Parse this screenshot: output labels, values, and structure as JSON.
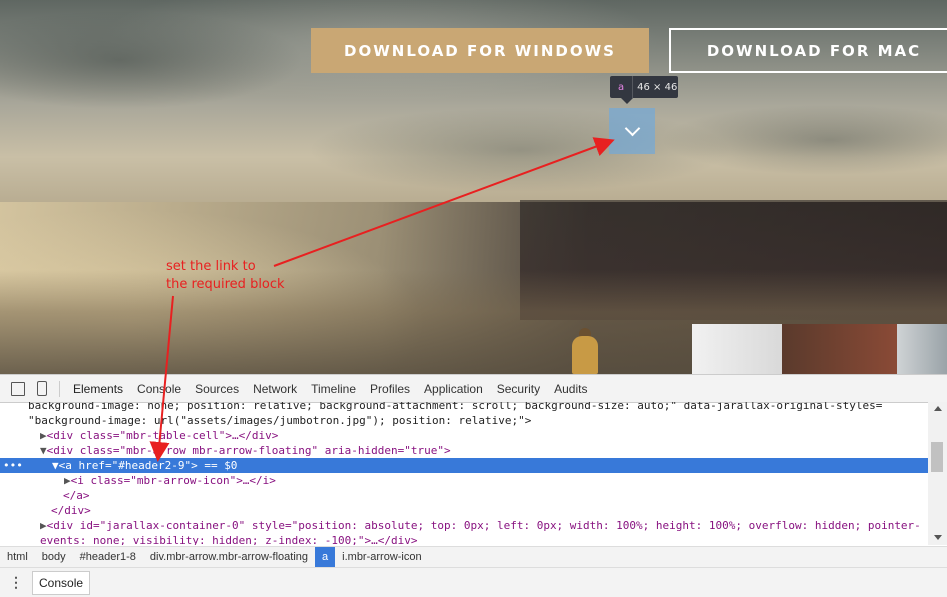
{
  "page": {
    "download_windows": "DOWNLOAD FOR WINDOWS",
    "download_mac": "DOWNLOAD FOR MAC",
    "tooltip_tag": "a",
    "tooltip_size": "46 × 46",
    "annotation": "set the link to\nthe required block"
  },
  "devtools": {
    "tabs": [
      "Elements",
      "Console",
      "Sources",
      "Network",
      "Timeline",
      "Profiles",
      "Application",
      "Security",
      "Audits"
    ],
    "active_tab": "Elements",
    "dom_lines": [
      "background-image: none; position: relative; background-attachment: scroll; background-size: auto;\" data-jarallax-original-styles=",
      "\"background-image: url(\"assets/images/jumbotron.jpg\"); position: relative;\">",
      "<div class=\"mbr-table-cell\">…</div>",
      "<div class=\"mbr-arrow mbr-arrow-floating\" aria-hidden=\"true\">",
      "<a href=\"#header2-9\"> == $0",
      "<i class=\"mbr-arrow-icon\">…</i>",
      "</a>",
      "</div>",
      "<div id=\"jarallax-container-0\" style=\"position: absolute; top: 0px; left: 0px; width: 100%; height: 100%; overflow: hidden; pointer-",
      "events: none; visibility: hidden; z-index: -100;\">…</div>"
    ],
    "selected_dots": "•••",
    "breadcrumbs": [
      "html",
      "body",
      "#header1-8",
      "div.mbr-arrow.mbr-arrow-floating",
      "a",
      "i.mbr-arrow-icon"
    ],
    "console_tab": "Console"
  },
  "colors": {
    "accent_button": "#c9a774",
    "selection": "#3879d9",
    "annotation": "#e82020"
  }
}
